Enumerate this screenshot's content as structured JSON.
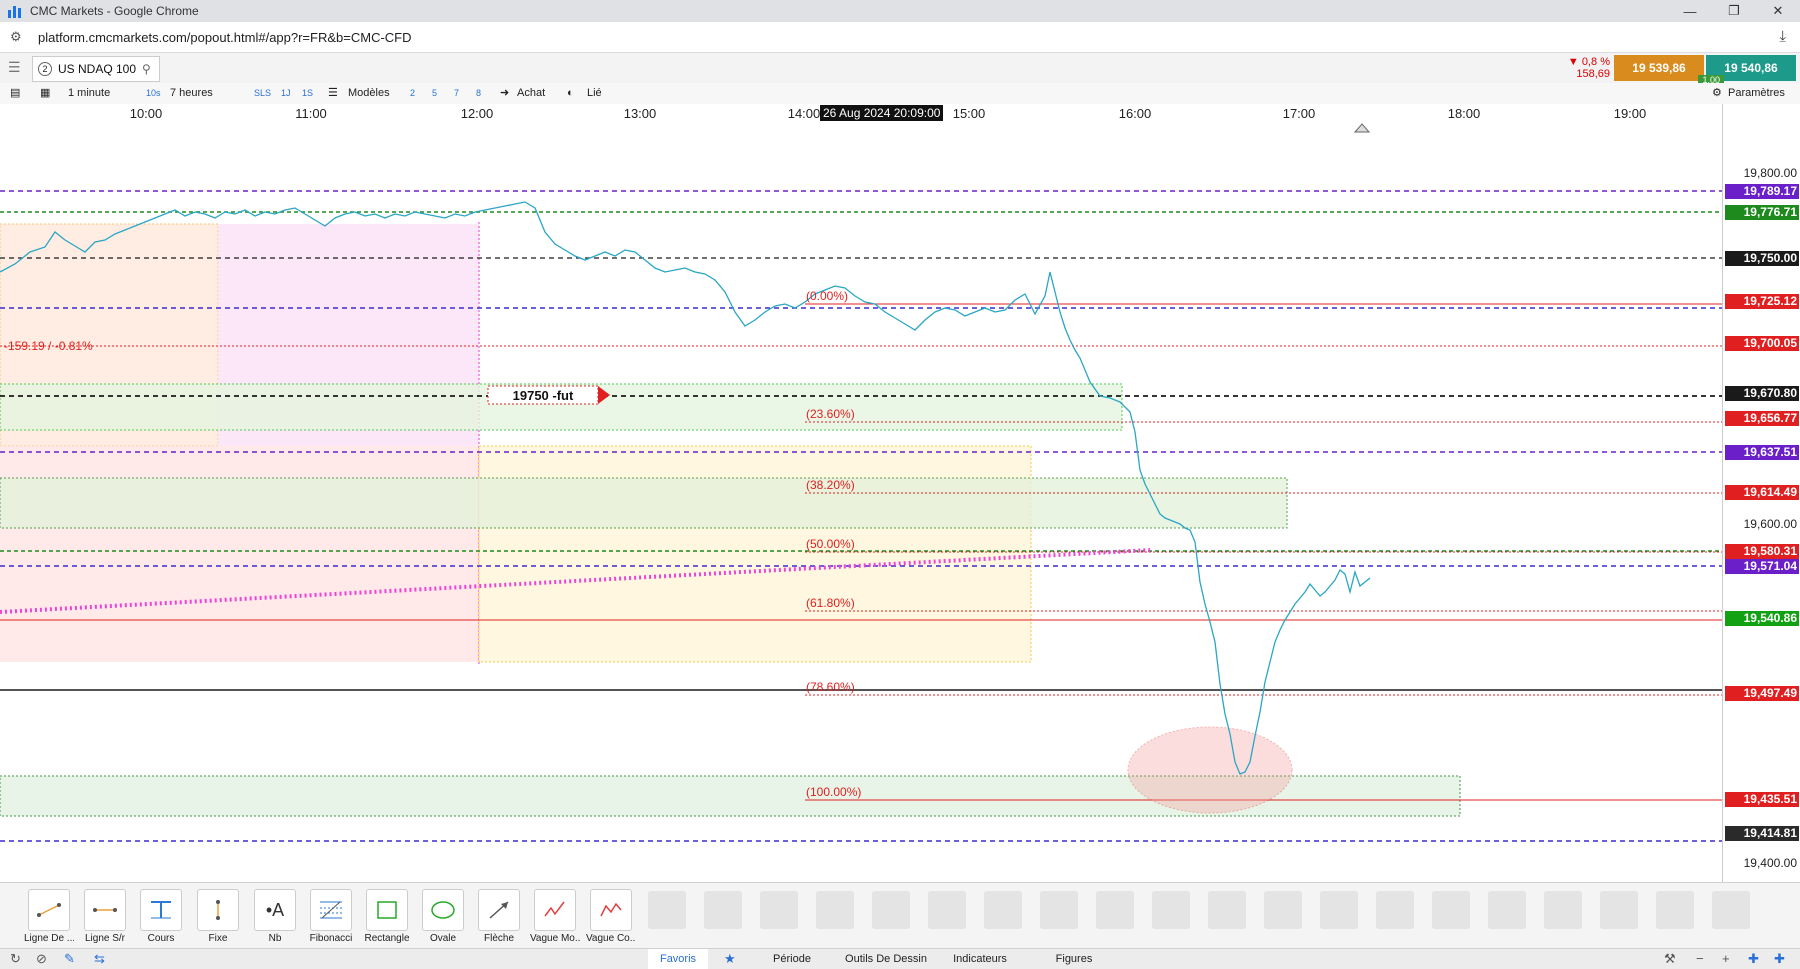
{
  "browser": {
    "window_title": "CMC Markets - Google Chrome",
    "url": "platform.cmcmarkets.com/popout.html#/app?r=FR&b=CMC-CFD"
  },
  "instrument": {
    "tab_number": "2",
    "name": "US NDAQ 100",
    "change_pct": "▼ 0,8 %",
    "change_pts": "158,69",
    "sell_price": "19 539,86",
    "buy_price": "19 540,86",
    "spread": "1.00"
  },
  "toolbar": {
    "interval": "1 minute",
    "quick_interval": "10s",
    "range": "7 heures",
    "sls": "SLS",
    "one_j": "1J",
    "one_s": "1S",
    "models": "Modèles",
    "presets": [
      "2",
      "5",
      "7",
      "8"
    ],
    "buy": "Achat",
    "linked": "Lié",
    "settings": "Paramètres"
  },
  "time_axis": {
    "ticks": [
      "10:00",
      "11:00",
      "12:00",
      "13:00",
      "14:00",
      "15:00",
      "16:00",
      "17:00",
      "18:00",
      "19:00"
    ],
    "cursor_label": "26 Aug 2024 20:09:00"
  },
  "chart": {
    "change_text": "-159.19 / -0.81%",
    "alert_label": "19750 -fut",
    "fib_levels": [
      "(0.00%)",
      "(23.60%)",
      "(38.20%)",
      "(50.00%)",
      "(61.80%)",
      "(78.60%)",
      "(100.00%)"
    ],
    "ticks": [
      "19,800.00",
      "19,600.00",
      "19,400.00"
    ],
    "price_labels": [
      {
        "text": "19,789.17",
        "color": "#6a1fc9"
      },
      {
        "text": "19,776.71",
        "color": "#1e8a1e"
      },
      {
        "text": "19,750.00",
        "color": "#1a1a1a"
      },
      {
        "text": "19,725.12",
        "color": "#e02020"
      },
      {
        "text": "19,700.05",
        "color": "#e02020"
      },
      {
        "text": "19,670.80",
        "color": "#1a1a1a"
      },
      {
        "text": "19,656.77",
        "color": "#e02020"
      },
      {
        "text": "19,637.51",
        "color": "#6a1fc9"
      },
      {
        "text": "19,614.49",
        "color": "#e02020"
      },
      {
        "text": "19,580.31",
        "color": "#e02020"
      },
      {
        "text": "19,571.04",
        "color": "#6a1fc9"
      },
      {
        "text": "19,540.86",
        "color": "#12a112"
      },
      {
        "text": "19,497.49",
        "color": "#e02020"
      },
      {
        "text": "19,435.51",
        "color": "#e02020"
      },
      {
        "text": "19,414.81",
        "color": "#2a2a2a"
      }
    ]
  },
  "drawing_tools": [
    "Ligne De ...",
    "Ligne S/r",
    "Cours",
    "Fixe",
    "Nb",
    "Fibonacci",
    "Rectangle",
    "Ovale",
    "Flèche",
    "Vague Mo...",
    "Vague Co..."
  ],
  "bottom_tabs": [
    "Favoris",
    "Période",
    "Outils De Dessin",
    "Indicateurs",
    "Figures"
  ]
}
